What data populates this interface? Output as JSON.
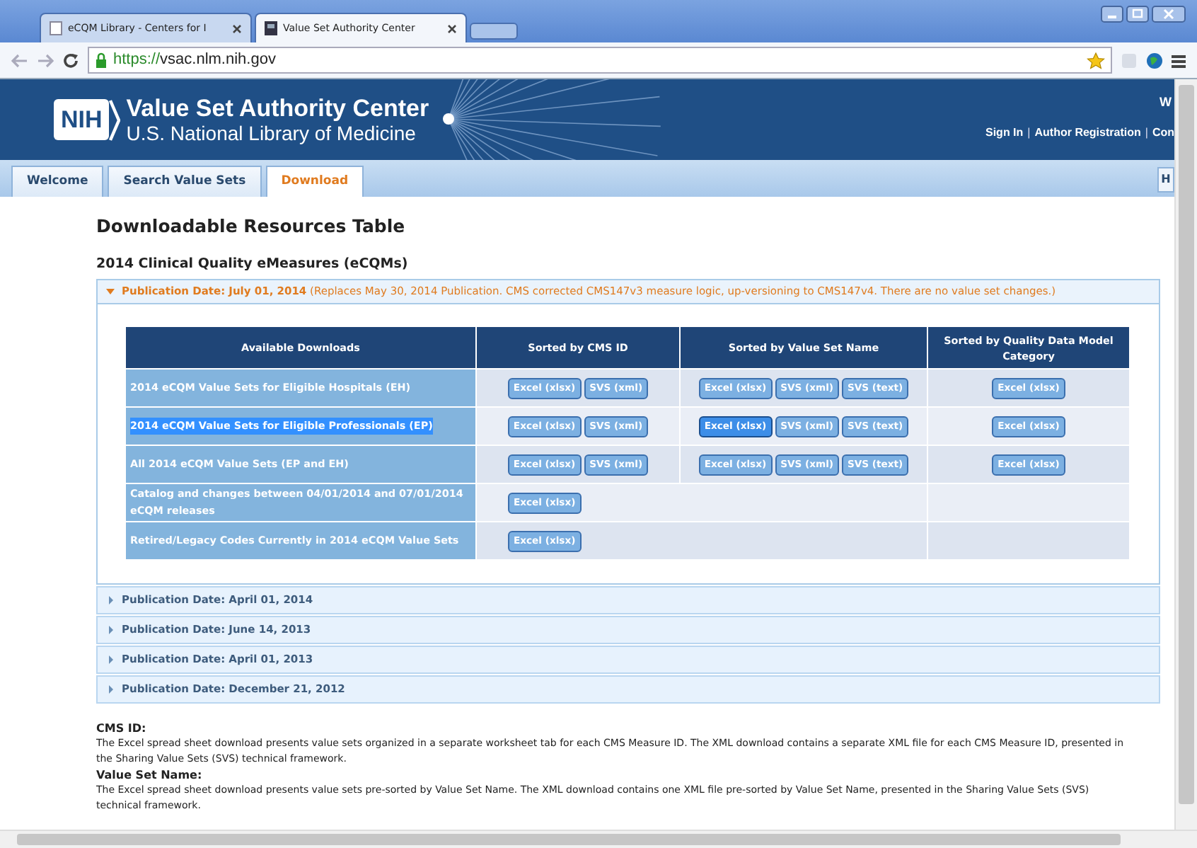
{
  "browser": {
    "tabs": [
      {
        "title": "eCQM Library - Centers for I",
        "selected": false
      },
      {
        "title": "Value Set Authority Center",
        "selected": true
      }
    ],
    "url_scheme": "https://",
    "url_host": "vsac.nlm.nih.gov"
  },
  "header": {
    "logo": "NIH",
    "title": "Value Set Authority Center",
    "subtitle": "U.S. National Library of Medicine",
    "corner_text": "W",
    "links": [
      {
        "kind": "link",
        "text": "Sign In"
      },
      {
        "kind": "separator",
        "text": "|"
      },
      {
        "kind": "link",
        "text": "Author Registration"
      },
      {
        "kind": "separator",
        "text": "|"
      },
      {
        "kind": "link",
        "text": "Con"
      }
    ]
  },
  "site_tabs": [
    {
      "label": "Welcome",
      "selected": false
    },
    {
      "label": "Search Value Sets",
      "selected": false
    },
    {
      "label": "Download",
      "selected": true
    }
  ],
  "right_tab": "H",
  "heading": "Downloadable Resources Table",
  "section_title": "2014 Clinical Quality eMeasures (eCQMs)",
  "expanded_panel": {
    "expanded": true,
    "date": "Publication Date: July 01, 2014",
    "note": "(Replaces May 30, 2014 Publication. CMS corrected CMS147v3 measure logic, up-versioning to CMS147v4. There are no value set changes.)",
    "table": {
      "label_column": "Available Downloads",
      "columns": [
        "Sorted by CMS ID",
        "Sorted by Value Set Name",
        "Sorted by Quality Data Model Category"
      ],
      "rows": [
        {
          "label": "2014 eCQM Value Sets for Eligible Hospitals (EH)",
          "selected": false,
          "cells": [
            [
              {
                "label": "Excel (xlsx)",
                "highlighted": false
              },
              {
                "label": "SVS (xml)",
                "highlighted": false
              }
            ],
            [
              {
                "label": "Excel (xlsx)",
                "highlighted": false
              },
              {
                "label": "SVS (xml)",
                "highlighted": false
              },
              {
                "label": "SVS (text)",
                "highlighted": false
              }
            ],
            [
              {
                "label": "Excel (xlsx)",
                "highlighted": false
              }
            ]
          ]
        },
        {
          "label": "2014 eCQM Value Sets for Eligible Professionals (EP)",
          "selected": true,
          "cells": [
            [
              {
                "label": "Excel (xlsx)",
                "highlighted": false
              },
              {
                "label": "SVS (xml)",
                "highlighted": false
              }
            ],
            [
              {
                "label": "Excel (xlsx)",
                "highlighted": true
              },
              {
                "label": "SVS (xml)",
                "highlighted": false
              },
              {
                "label": "SVS (text)",
                "highlighted": false
              }
            ],
            [
              {
                "label": "Excel (xlsx)",
                "highlighted": false
              }
            ]
          ]
        },
        {
          "label": "All 2014 eCQM Value Sets (EP and EH)",
          "selected": false,
          "cells": [
            [
              {
                "label": "Excel (xlsx)",
                "highlighted": false
              },
              {
                "label": "SVS (xml)",
                "highlighted": false
              }
            ],
            [
              {
                "label": "Excel (xlsx)",
                "highlighted": false
              },
              {
                "label": "SVS (xml)",
                "highlighted": false
              },
              {
                "label": "SVS (text)",
                "highlighted": false
              }
            ],
            [
              {
                "label": "Excel (xlsx)",
                "highlighted": false
              }
            ]
          ]
        },
        {
          "label": "Catalog and changes between 04/01/2014 and 07/01/2014 eCQM releases",
          "selected": false,
          "cells": [
            [
              {
                "label": "Excel (xlsx)",
                "highlighted": false
              }
            ]
          ]
        },
        {
          "label": "Retired/Legacy Codes Currently in 2014 eCQM Value Sets",
          "selected": false,
          "cells": [
            [
              {
                "label": "Excel (xlsx)",
                "highlighted": false
              }
            ]
          ]
        }
      ]
    }
  },
  "collapsed_panels": [
    {
      "label": "Publication Date: April 01, 2014",
      "expanded": false
    },
    {
      "label": "Publication Date: June 14, 2013",
      "expanded": false
    },
    {
      "label": "Publication Date: April 01, 2013",
      "expanded": false
    },
    {
      "label": "Publication Date: December 21, 2012",
      "expanded": false
    }
  ],
  "notes": [
    {
      "title": "CMS ID:",
      "text": "The Excel spread sheet download presents value sets organized in a separate worksheet tab for each CMS Measure ID. The XML download contains a separate XML file for each CMS Measure ID, presented in the",
      "link": "Sharing Value Sets (SVS) technical framework."
    },
    {
      "title": "Value Set Name:",
      "text": "The Excel spread sheet download presents value sets pre-sorted by Value Set Name. The XML download contains one XML file pre-sorted by Value Set Name, presented in the Sharing Value Sets (SVS) technical framework."
    }
  ]
}
